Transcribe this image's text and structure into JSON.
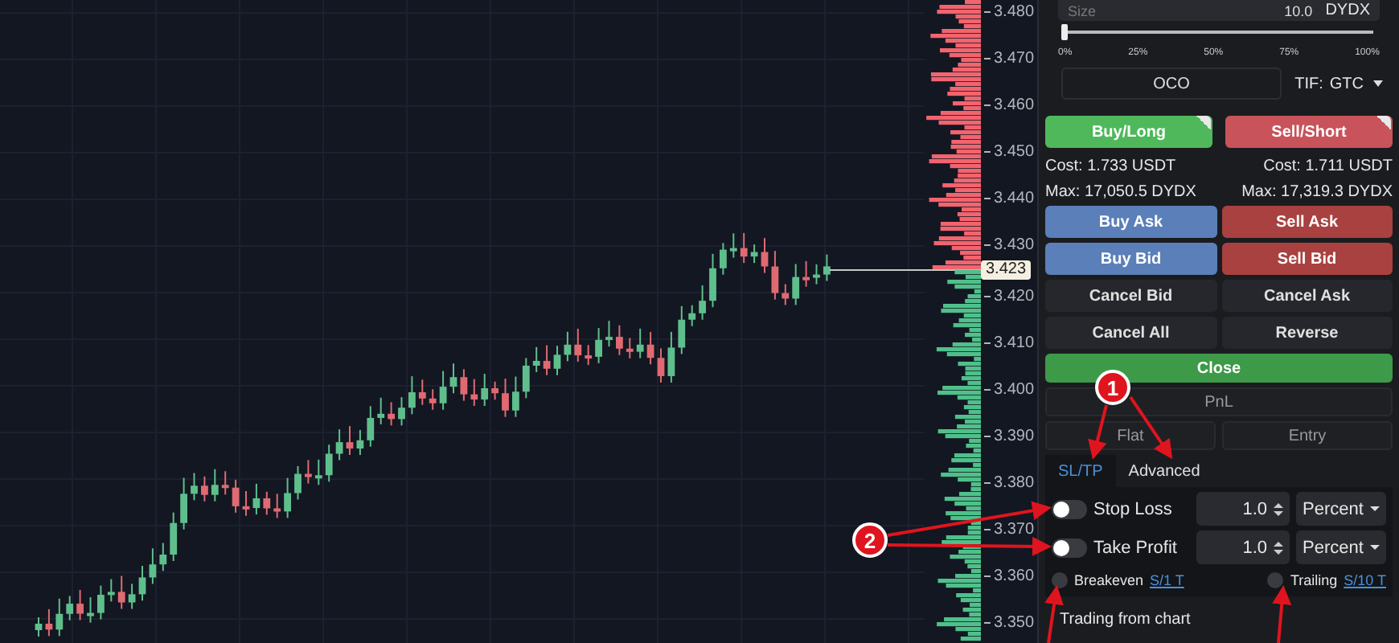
{
  "chart": {
    "price_ticks": [
      "3.480",
      "3.470",
      "3.460",
      "3.450",
      "3.440",
      "3.430",
      "3.420",
      "3.410",
      "3.400",
      "3.390",
      "3.380",
      "3.370",
      "3.360",
      "3.350"
    ],
    "last_price": "3.423"
  },
  "order_form": {
    "size": {
      "placeholder": "Size",
      "value": "10.0",
      "unit": "DYDX"
    },
    "slider": {
      "level": 0,
      "ticks": [
        "0%",
        "25%",
        "50%",
        "75%",
        "100%"
      ]
    },
    "oco_button": "OCO",
    "tif": {
      "label": "TIF:",
      "value": "GTC"
    }
  },
  "sides": [
    {
      "kind": "buy",
      "label": "Buy/Long",
      "cost": "Cost: 1.733 USDT",
      "max": "Max: 17,050.5 DYDX"
    },
    {
      "kind": "sell",
      "label": "Sell/Short",
      "cost": "Cost: 1.711 USDT",
      "max": "Max: 17,319.3 DYDX"
    }
  ],
  "action_buttons": [
    {
      "label": "Buy Ask",
      "kind": "buy"
    },
    {
      "label": "Sell Ask",
      "kind": "sell"
    },
    {
      "label": "Buy Bid",
      "kind": "buy"
    },
    {
      "label": "Sell Bid",
      "kind": "sell"
    },
    {
      "label": "Cancel Bid",
      "kind": "neutral"
    },
    {
      "label": "Cancel Ask",
      "kind": "neutral"
    },
    {
      "label": "Cancel All",
      "kind": "neutral"
    },
    {
      "label": "Reverse",
      "kind": "neutral"
    },
    {
      "label": "Close",
      "kind": "close"
    }
  ],
  "pnl_button": "PnL",
  "position_buttons": [
    "Flat",
    "Entry"
  ],
  "tabs": [
    {
      "label": "SL/TP",
      "selected": true
    },
    {
      "label": "Advanced",
      "selected": false
    }
  ],
  "protection": [
    {
      "label": "Stop Loss",
      "on": false,
      "value": "1.0",
      "mode": "Percent"
    },
    {
      "label": "Take Profit",
      "on": false,
      "value": "1.0",
      "mode": "Percent"
    }
  ],
  "options": [
    {
      "label": "Breakeven",
      "checked": false,
      "link": "S/1 T"
    },
    {
      "label": "Trailing",
      "checked": false,
      "link": "S/10 T"
    }
  ],
  "section_title": "Trading from chart",
  "annotations": [
    {
      "label": "1"
    },
    {
      "label": "2"
    }
  ]
}
